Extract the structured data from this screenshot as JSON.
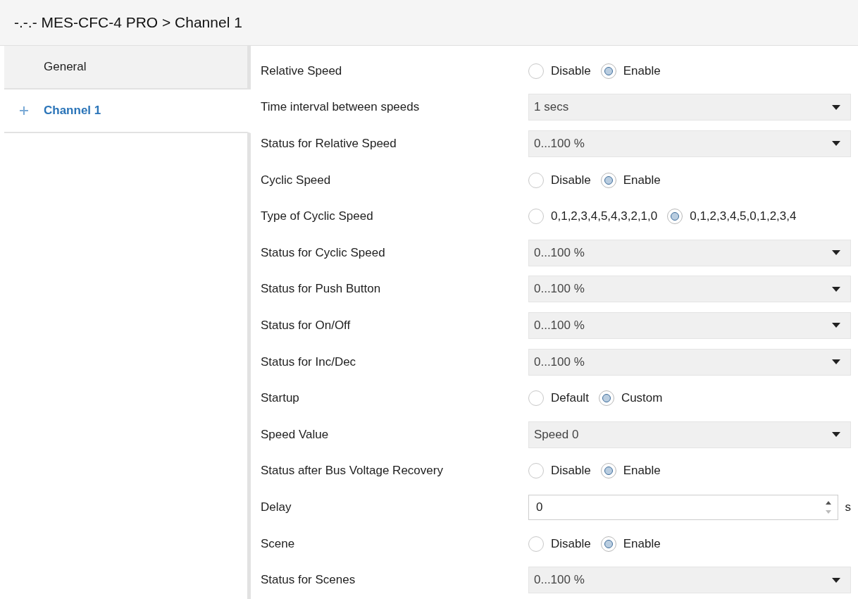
{
  "header": {
    "title": "-.-.- MES-CFC-4 PRO > Channel 1"
  },
  "sidebar": {
    "items": [
      {
        "label": "General",
        "selected": false,
        "expandable": false
      },
      {
        "label": "Channel 1",
        "selected": true,
        "expandable": true
      }
    ]
  },
  "parameters": [
    {
      "kind": "radio",
      "label": "Relative Speed",
      "options": [
        {
          "label": "Disable",
          "selected": false
        },
        {
          "label": "Enable",
          "selected": true
        }
      ]
    },
    {
      "kind": "select",
      "label": "Time interval between speeds",
      "value": "1 secs"
    },
    {
      "kind": "select",
      "label": "Status for Relative Speed",
      "value": "0...100 %"
    },
    {
      "kind": "radio",
      "label": "Cyclic Speed",
      "options": [
        {
          "label": "Disable",
          "selected": false
        },
        {
          "label": "Enable",
          "selected": true
        }
      ]
    },
    {
      "kind": "radio",
      "label": "Type of Cyclic Speed",
      "options": [
        {
          "label": "0,1,2,3,4,5,4,3,2,1,0",
          "selected": false
        },
        {
          "label": "0,1,2,3,4,5,0,1,2,3,4",
          "selected": true
        }
      ]
    },
    {
      "kind": "select",
      "label": "Status for Cyclic Speed",
      "value": "0...100 %"
    },
    {
      "kind": "select",
      "label": "Status for Push Button",
      "value": "0...100 %"
    },
    {
      "kind": "select",
      "label": "Status for On/Off",
      "value": "0...100 %"
    },
    {
      "kind": "select",
      "label": "Status for Inc/Dec",
      "value": "0...100 %"
    },
    {
      "kind": "radio",
      "label": "Startup",
      "options": [
        {
          "label": "Default",
          "selected": false
        },
        {
          "label": "Custom",
          "selected": true
        }
      ]
    },
    {
      "kind": "select",
      "label": "Speed Value",
      "value": "Speed 0"
    },
    {
      "kind": "radio",
      "label": "Status after Bus Voltage Recovery",
      "options": [
        {
          "label": "Disable",
          "selected": false
        },
        {
          "label": "Enable",
          "selected": true
        }
      ]
    },
    {
      "kind": "number",
      "label": "Delay",
      "value": "0",
      "unit": "s"
    },
    {
      "kind": "radio",
      "label": "Scene",
      "options": [
        {
          "label": "Disable",
          "selected": false
        },
        {
          "label": "Enable",
          "selected": true
        }
      ]
    },
    {
      "kind": "select",
      "label": "Status for Scenes",
      "value": "0...100 %"
    }
  ]
}
